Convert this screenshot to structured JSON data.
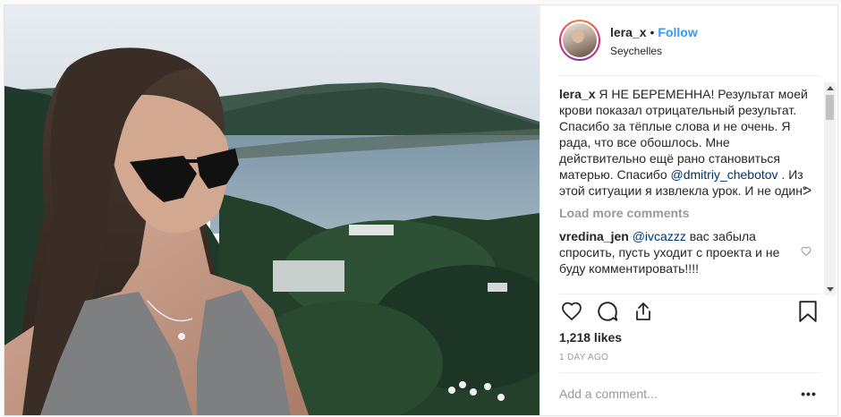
{
  "post": {
    "username": "lera_x",
    "separator": "•",
    "follow_label": "Follow",
    "location": "Seychelles"
  },
  "caption": {
    "username": "lera_x",
    "text_1": " Я НЕ БЕРЕМЕННА! Результат моей крови показал отрицательный результат. Спасибо за тёплые слова и не очень. Я рада, что все обошлось. Мне действительно ещё рано становиться матерью. Спасибо ",
    "mention": "@dmitriy_chebotov",
    "text_2": " . Из этой ситуации я извлекла урок. И не одинᕗ"
  },
  "load_more_label": "Load more comments",
  "comments": [
    {
      "username": "vredina_jen",
      "mention": "@ivcazzz",
      "text": " вас забыла спросить, пусть уходит с проекта и не буду комментировать!!!!"
    }
  ],
  "icons": {
    "like": "heart-icon",
    "comment": "comment-icon",
    "share": "share-icon",
    "save": "bookmark-icon",
    "comment_like": "heart-icon",
    "more": "more-options-icon"
  },
  "likes_text": "1,218 likes",
  "timestamp": "1 DAY AGO",
  "add_comment_placeholder": "Add a comment...",
  "more_label": "•••",
  "colors": {
    "link": "#3897f0",
    "mention": "#003569",
    "muted": "#999999",
    "border": "#efefef"
  }
}
